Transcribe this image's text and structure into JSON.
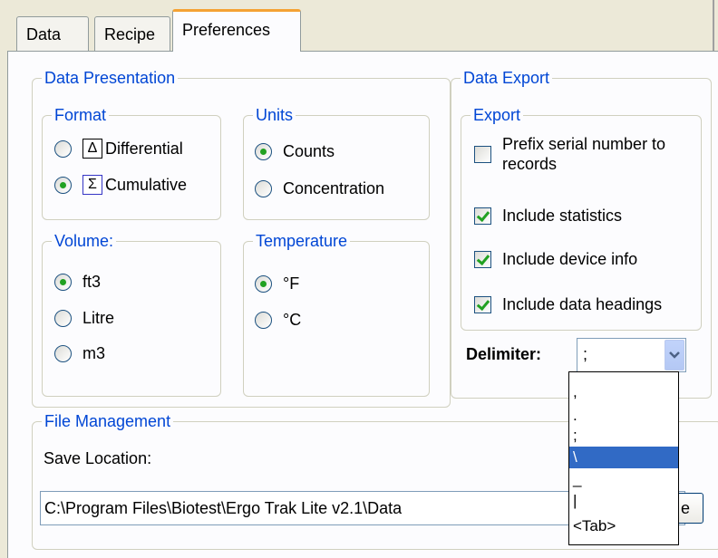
{
  "tabs": [
    {
      "label": "Data"
    },
    {
      "label": "Recipe"
    },
    {
      "label": "Preferences"
    }
  ],
  "data_presentation": {
    "title": "Data Presentation",
    "format": {
      "title": "Format",
      "options": [
        {
          "glyph": "Δ",
          "label": "Differential",
          "selected": false
        },
        {
          "glyph": "Σ",
          "label": "Cumulative",
          "selected": true
        }
      ]
    },
    "units": {
      "title": "Units",
      "options": [
        {
          "label": "Counts",
          "selected": true
        },
        {
          "label": "Concentration",
          "selected": false
        }
      ]
    },
    "volume": {
      "title": "Volume:",
      "options": [
        {
          "label": "ft3",
          "selected": true
        },
        {
          "label": "Litre",
          "selected": false
        },
        {
          "label": "m3",
          "selected": false
        }
      ]
    },
    "temperature": {
      "title": "Temperature",
      "options": [
        {
          "label": "°F",
          "selected": true
        },
        {
          "label": "°C",
          "selected": false
        }
      ]
    }
  },
  "data_export": {
    "title": "Data Export",
    "export": {
      "title": "Export",
      "options": [
        {
          "label_line1": "Prefix serial number to",
          "label_line2": "records",
          "checked": false
        },
        {
          "label": "Include statistics",
          "checked": true
        },
        {
          "label": "Include device info",
          "checked": true
        },
        {
          "label": "Include data headings",
          "checked": true
        }
      ]
    },
    "delimiter": {
      "label": "Delimiter:",
      "value": ";",
      "options": [
        ",",
        ".",
        ";",
        "\\",
        "_",
        "|",
        "<Tab>"
      ],
      "highlighted": "\\"
    }
  },
  "file_management": {
    "title": "File Management",
    "save_location_label": "Save Location:",
    "save_location_value": "C:\\Program Files\\Biotest\\Ergo Trak Lite v2.1\\Data",
    "browse_label": "e"
  },
  "colors": {
    "group_title": "#0046d5",
    "selection": "#316ac5",
    "tab_accent": "#f4a234",
    "check_mark": "#21a121"
  }
}
